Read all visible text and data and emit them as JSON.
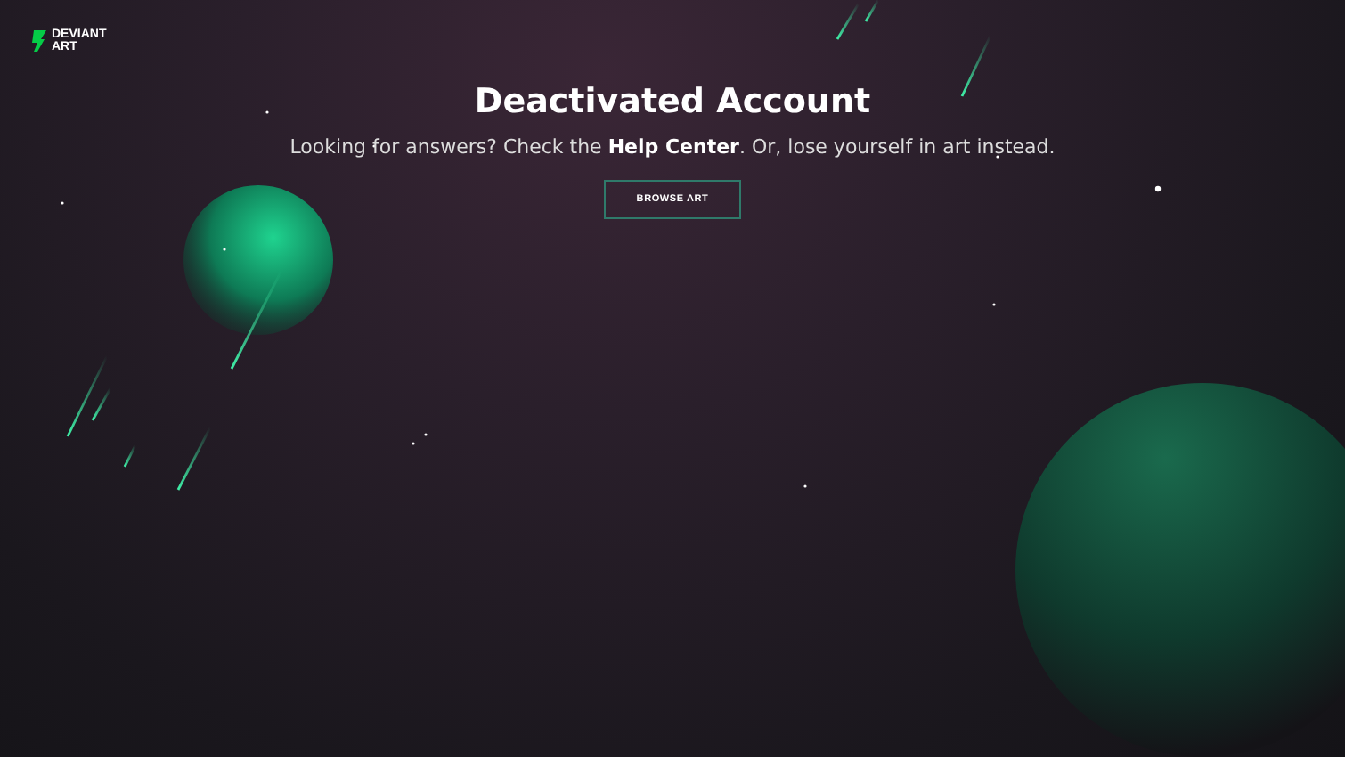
{
  "logo": {
    "lines": [
      "DEVIANT",
      "ART"
    ]
  },
  "title": "Deactivated Account",
  "message": {
    "before": "Looking for answers? Check the ",
    "link": "Help Center",
    "after": ". Or, lose yourself in art instead."
  },
  "button": "BROWSE ART"
}
